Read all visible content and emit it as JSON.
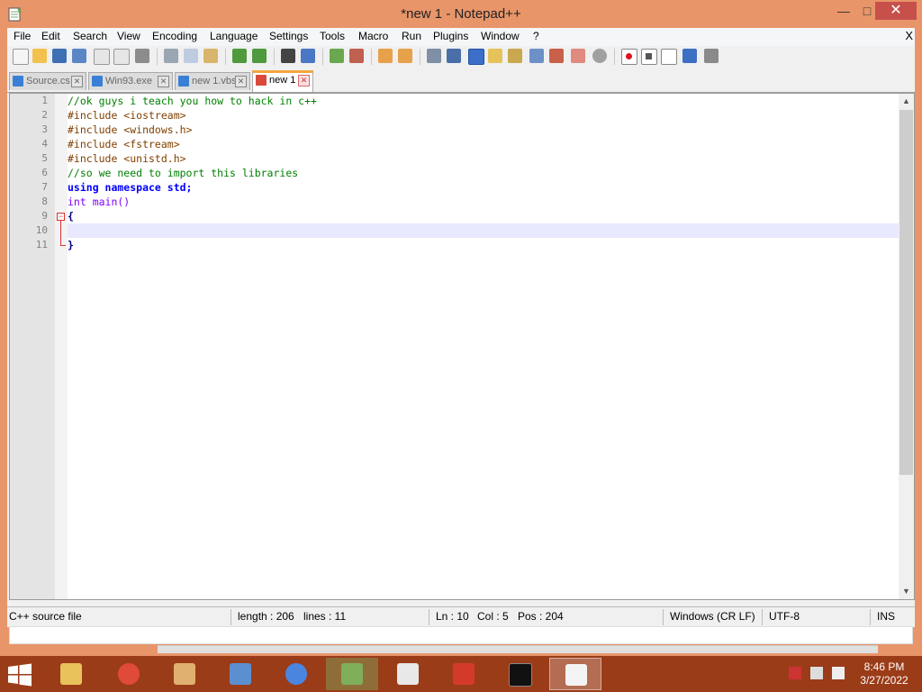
{
  "window": {
    "title": "*new 1 - Notepad++",
    "controls": {
      "minimize": "—",
      "maximize": "□",
      "close": "✕"
    }
  },
  "menu": {
    "items": [
      "File",
      "Edit",
      "Search",
      "View",
      "Encoding",
      "Language",
      "Settings",
      "Tools",
      "Macro",
      "Run",
      "Plugins",
      "Window",
      "?"
    ],
    "close": "X"
  },
  "toolbar": {
    "icons": [
      "new-file-icon",
      "open-file-icon",
      "save-icon",
      "save-all-icon",
      "close-icon",
      "close-all-icon",
      "print-icon",
      "cut-icon",
      "copy-icon",
      "paste-icon",
      "undo-icon",
      "redo-icon",
      "find-icon",
      "replace-icon",
      "zoom-in-icon",
      "zoom-out-icon",
      "sync-vertical-icon",
      "sync-horizontal-icon",
      "word-wrap-icon",
      "show-all-chars-icon",
      "indent-guide-icon",
      "udl-icon",
      "doc-map-icon",
      "function-list-icon",
      "folder-workspace-icon",
      "monitoring-icon",
      "record-macro-icon",
      "stop-macro-icon",
      "play-macro-icon",
      "run-macro-multiple-icon",
      "save-macro-icon"
    ]
  },
  "tabs": [
    {
      "label": "Source.cs",
      "active": false
    },
    {
      "label": "Win93.exe",
      "active": false
    },
    {
      "label": "new 1.vbs",
      "active": false
    },
    {
      "label": "new 1",
      "active": true
    }
  ],
  "editor": {
    "lines": [
      {
        "num": "1",
        "text": "//ok guys i teach you how to hack in c++",
        "style": "comment"
      },
      {
        "num": "2",
        "text": "#include <iostream>",
        "style": "prep"
      },
      {
        "num": "3",
        "text": "#include <windows.h>",
        "style": "prep"
      },
      {
        "num": "4",
        "text": "#include <fstream>",
        "style": "prep"
      },
      {
        "num": "5",
        "text": "#include <unistd.h>",
        "style": "prep"
      },
      {
        "num": "6",
        "text": "//so we need to import this libraries",
        "style": "comment"
      },
      {
        "num": "7",
        "text": "using namespace std;",
        "style": "using"
      },
      {
        "num": "8",
        "text": "int main()",
        "style": "main"
      },
      {
        "num": "9",
        "text": "{",
        "style": "op"
      },
      {
        "num": "10",
        "text": "",
        "style": "plain"
      },
      {
        "num": "11",
        "text": "}",
        "style": "op"
      }
    ],
    "current_line": "10"
  },
  "status": {
    "file_type": "C++ source file",
    "length": "length : 206",
    "lines": "lines : 11",
    "ln": "Ln : 10",
    "col": "Col : 5",
    "pos": "Pos : 204",
    "eol": "Windows (CR LF)",
    "encoding": "UTF-8",
    "mode": "INS"
  },
  "taskbar": {
    "apps": [
      "file-explorer-icon",
      "chrome-icon",
      "paint-icon",
      "control-panel-icon",
      "chromium-icon",
      "network-setup-icon",
      "document-viewer-icon",
      "3d-builder-icon",
      "command-prompt-icon",
      "notepad-plus-plus-icon"
    ],
    "active_app": "notepad-plus-plus-icon",
    "time": "8:46 PM",
    "date": "3/27/2022"
  },
  "colors": {
    "title_bar": "#e8956a",
    "taskbar": "#9b3c18",
    "close_button": "#c7504b",
    "current_line_highlight": "#e8e8ff",
    "comment": "#008000",
    "preprocessor": "#804000",
    "keyword": "#0000ff",
    "type": "#8000ff"
  }
}
